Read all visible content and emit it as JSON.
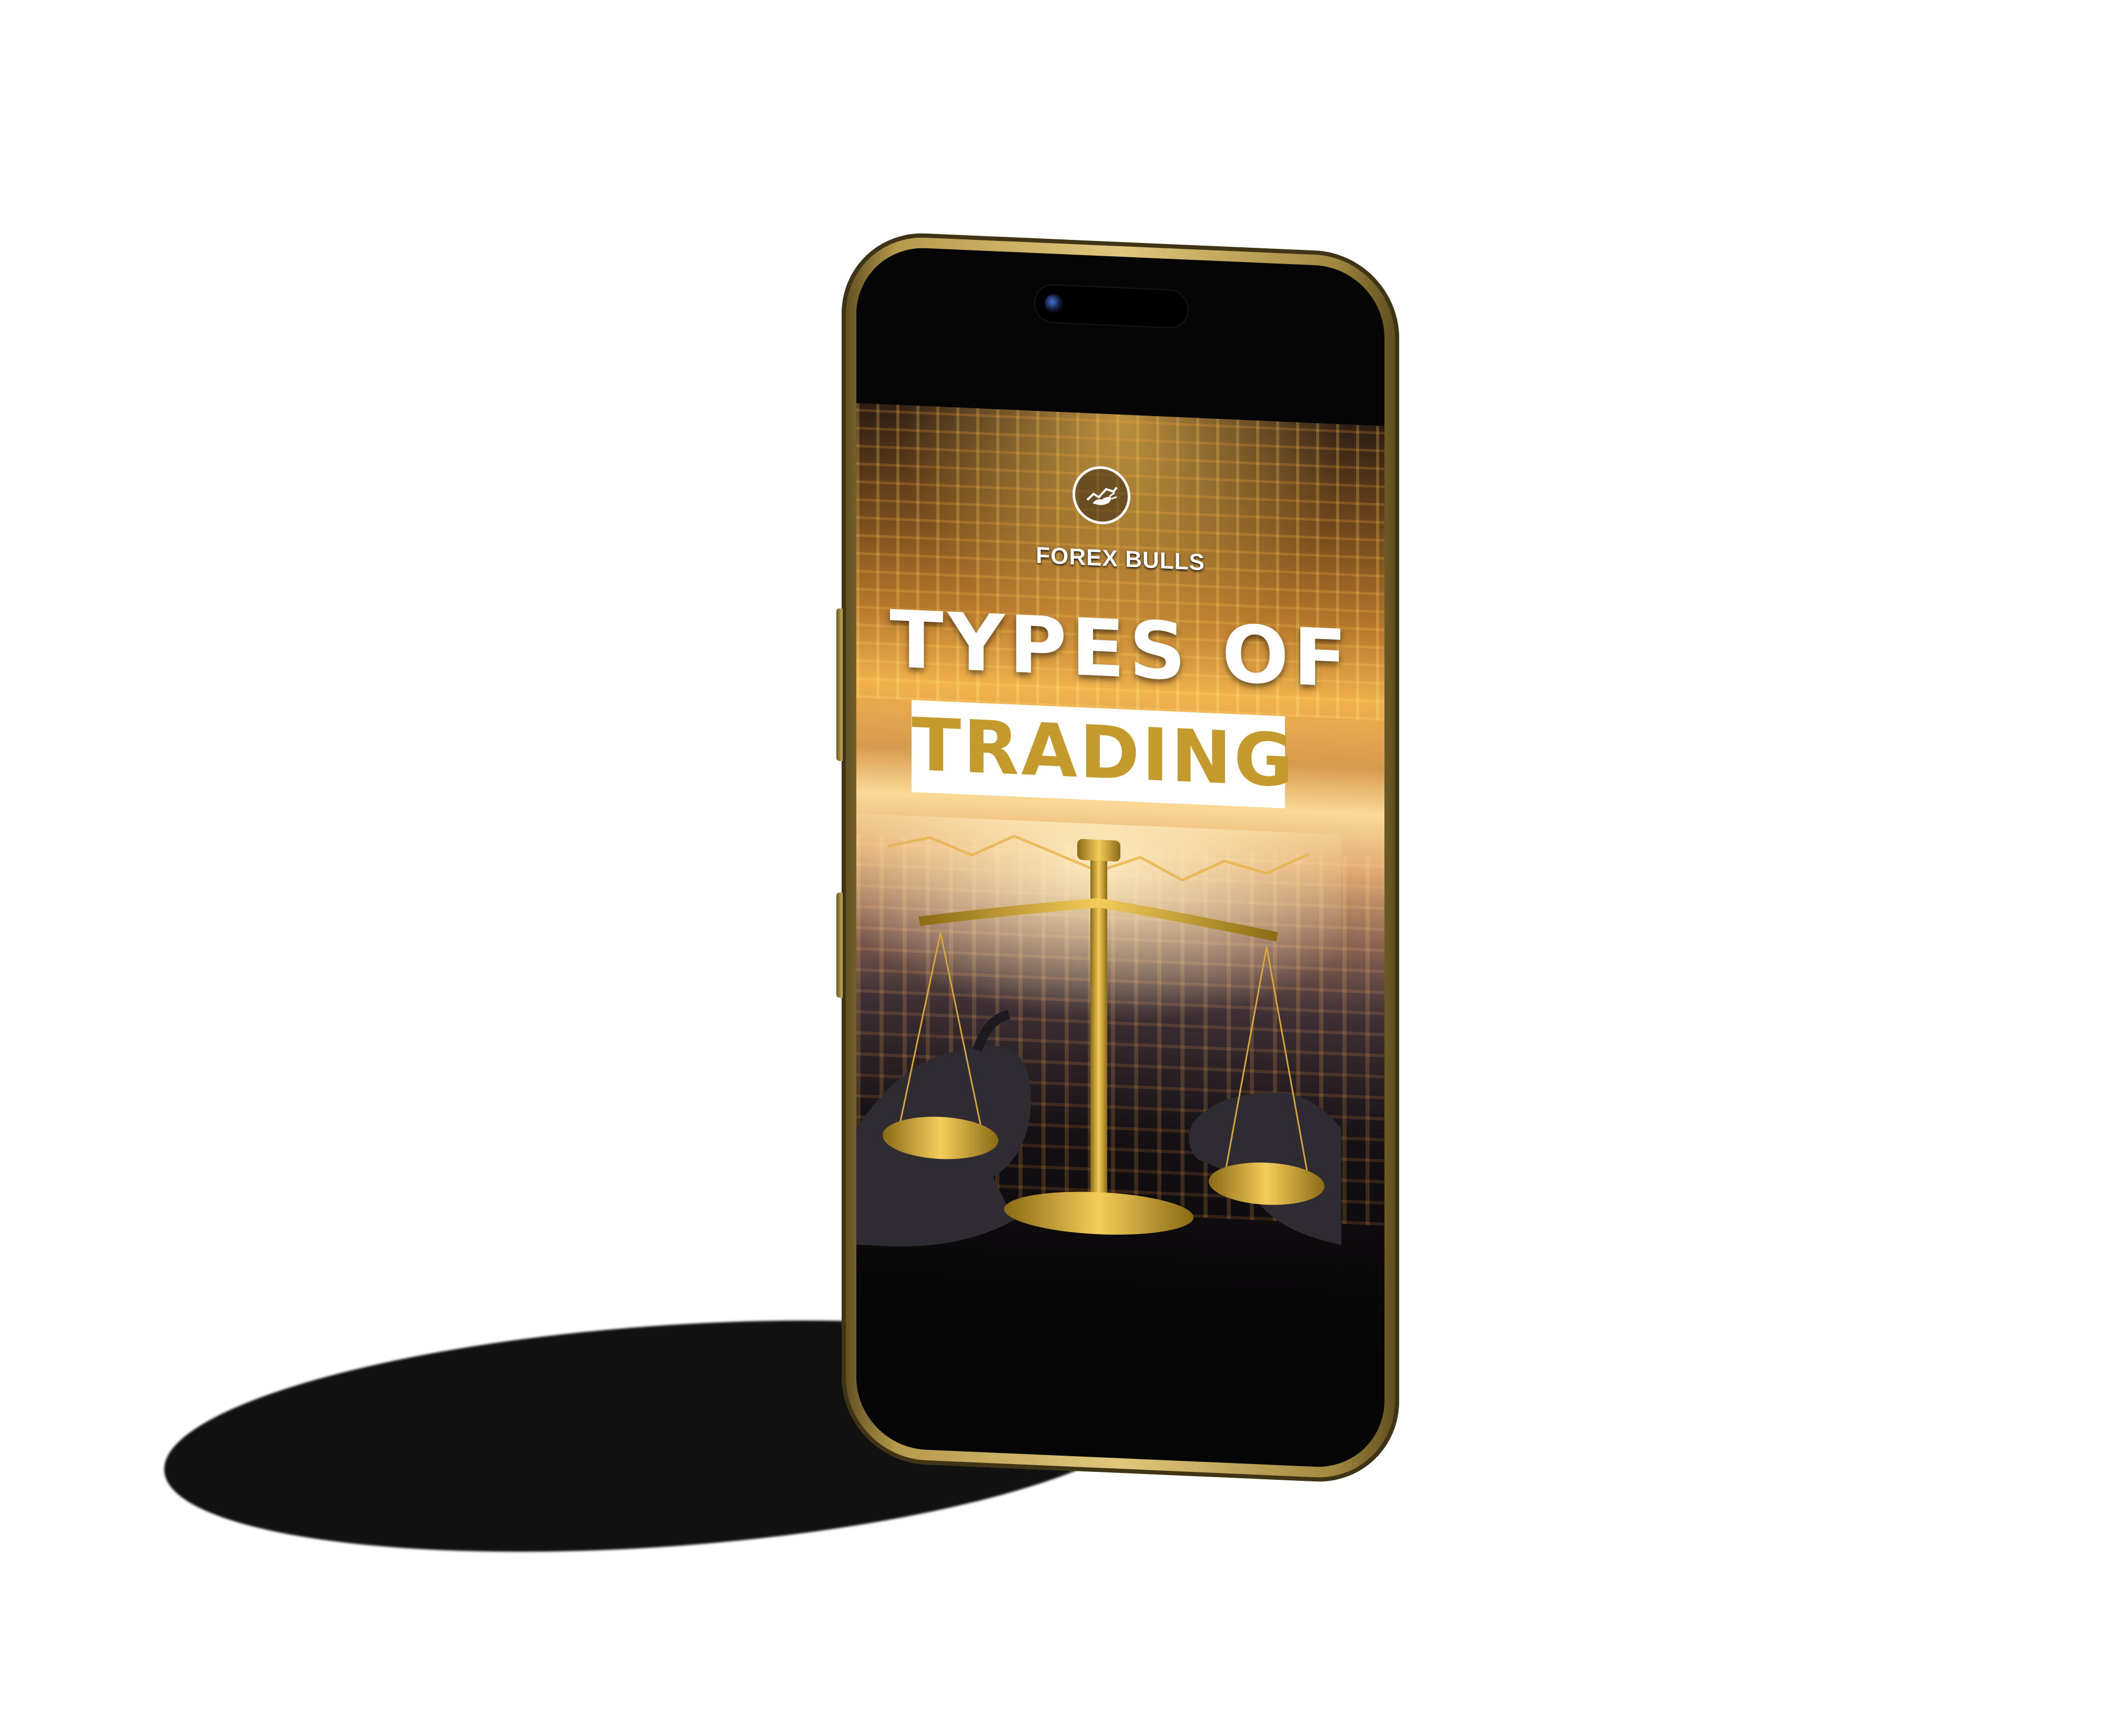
{
  "scene": {
    "description_colors": {
      "background": "#ffffff",
      "phone_frame": "#c9ad5b",
      "title_accent": "#c49a2c"
    }
  },
  "screen": {
    "logo_text": "FOREX BULLS",
    "title_line_1": "TYPES OF",
    "title_line_2": "TRADING"
  },
  "icons": {
    "logo": "bull-logo-icon",
    "art": "bull-bear-scale-illustration"
  }
}
